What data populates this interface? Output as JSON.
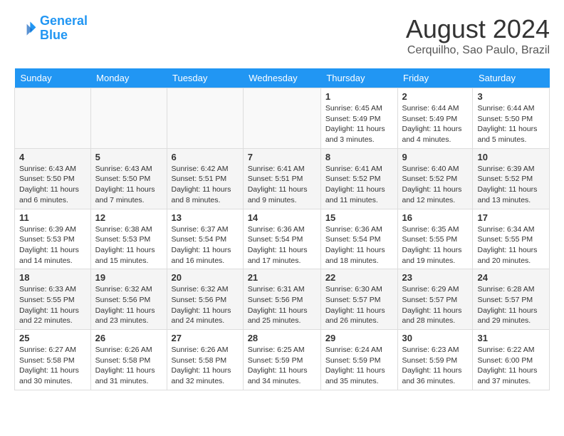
{
  "logo": {
    "line1": "General",
    "line2": "Blue"
  },
  "title": "August 2024",
  "location": "Cerquilho, Sao Paulo, Brazil",
  "days": [
    "Sunday",
    "Monday",
    "Tuesday",
    "Wednesday",
    "Thursday",
    "Friday",
    "Saturday"
  ],
  "weeks": [
    [
      {
        "date": "",
        "info": ""
      },
      {
        "date": "",
        "info": ""
      },
      {
        "date": "",
        "info": ""
      },
      {
        "date": "",
        "info": ""
      },
      {
        "date": "1",
        "info": "Sunrise: 6:45 AM\nSunset: 5:49 PM\nDaylight: 11 hours and 3 minutes."
      },
      {
        "date": "2",
        "info": "Sunrise: 6:44 AM\nSunset: 5:49 PM\nDaylight: 11 hours and 4 minutes."
      },
      {
        "date": "3",
        "info": "Sunrise: 6:44 AM\nSunset: 5:50 PM\nDaylight: 11 hours and 5 minutes."
      }
    ],
    [
      {
        "date": "4",
        "info": "Sunrise: 6:43 AM\nSunset: 5:50 PM\nDaylight: 11 hours and 6 minutes."
      },
      {
        "date": "5",
        "info": "Sunrise: 6:43 AM\nSunset: 5:50 PM\nDaylight: 11 hours and 7 minutes."
      },
      {
        "date": "6",
        "info": "Sunrise: 6:42 AM\nSunset: 5:51 PM\nDaylight: 11 hours and 8 minutes."
      },
      {
        "date": "7",
        "info": "Sunrise: 6:41 AM\nSunset: 5:51 PM\nDaylight: 11 hours and 9 minutes."
      },
      {
        "date": "8",
        "info": "Sunrise: 6:41 AM\nSunset: 5:52 PM\nDaylight: 11 hours and 11 minutes."
      },
      {
        "date": "9",
        "info": "Sunrise: 6:40 AM\nSunset: 5:52 PM\nDaylight: 11 hours and 12 minutes."
      },
      {
        "date": "10",
        "info": "Sunrise: 6:39 AM\nSunset: 5:52 PM\nDaylight: 11 hours and 13 minutes."
      }
    ],
    [
      {
        "date": "11",
        "info": "Sunrise: 6:39 AM\nSunset: 5:53 PM\nDaylight: 11 hours and 14 minutes."
      },
      {
        "date": "12",
        "info": "Sunrise: 6:38 AM\nSunset: 5:53 PM\nDaylight: 11 hours and 15 minutes."
      },
      {
        "date": "13",
        "info": "Sunrise: 6:37 AM\nSunset: 5:54 PM\nDaylight: 11 hours and 16 minutes."
      },
      {
        "date": "14",
        "info": "Sunrise: 6:36 AM\nSunset: 5:54 PM\nDaylight: 11 hours and 17 minutes."
      },
      {
        "date": "15",
        "info": "Sunrise: 6:36 AM\nSunset: 5:54 PM\nDaylight: 11 hours and 18 minutes."
      },
      {
        "date": "16",
        "info": "Sunrise: 6:35 AM\nSunset: 5:55 PM\nDaylight: 11 hours and 19 minutes."
      },
      {
        "date": "17",
        "info": "Sunrise: 6:34 AM\nSunset: 5:55 PM\nDaylight: 11 hours and 20 minutes."
      }
    ],
    [
      {
        "date": "18",
        "info": "Sunrise: 6:33 AM\nSunset: 5:55 PM\nDaylight: 11 hours and 22 minutes."
      },
      {
        "date": "19",
        "info": "Sunrise: 6:32 AM\nSunset: 5:56 PM\nDaylight: 11 hours and 23 minutes."
      },
      {
        "date": "20",
        "info": "Sunrise: 6:32 AM\nSunset: 5:56 PM\nDaylight: 11 hours and 24 minutes."
      },
      {
        "date": "21",
        "info": "Sunrise: 6:31 AM\nSunset: 5:56 PM\nDaylight: 11 hours and 25 minutes."
      },
      {
        "date": "22",
        "info": "Sunrise: 6:30 AM\nSunset: 5:57 PM\nDaylight: 11 hours and 26 minutes."
      },
      {
        "date": "23",
        "info": "Sunrise: 6:29 AM\nSunset: 5:57 PM\nDaylight: 11 hours and 28 minutes."
      },
      {
        "date": "24",
        "info": "Sunrise: 6:28 AM\nSunset: 5:57 PM\nDaylight: 11 hours and 29 minutes."
      }
    ],
    [
      {
        "date": "25",
        "info": "Sunrise: 6:27 AM\nSunset: 5:58 PM\nDaylight: 11 hours and 30 minutes."
      },
      {
        "date": "26",
        "info": "Sunrise: 6:26 AM\nSunset: 5:58 PM\nDaylight: 11 hours and 31 minutes."
      },
      {
        "date": "27",
        "info": "Sunrise: 6:26 AM\nSunset: 5:58 PM\nDaylight: 11 hours and 32 minutes."
      },
      {
        "date": "28",
        "info": "Sunrise: 6:25 AM\nSunset: 5:59 PM\nDaylight: 11 hours and 34 minutes."
      },
      {
        "date": "29",
        "info": "Sunrise: 6:24 AM\nSunset: 5:59 PM\nDaylight: 11 hours and 35 minutes."
      },
      {
        "date": "30",
        "info": "Sunrise: 6:23 AM\nSunset: 5:59 PM\nDaylight: 11 hours and 36 minutes."
      },
      {
        "date": "31",
        "info": "Sunrise: 6:22 AM\nSunset: 6:00 PM\nDaylight: 11 hours and 37 minutes."
      }
    ]
  ]
}
